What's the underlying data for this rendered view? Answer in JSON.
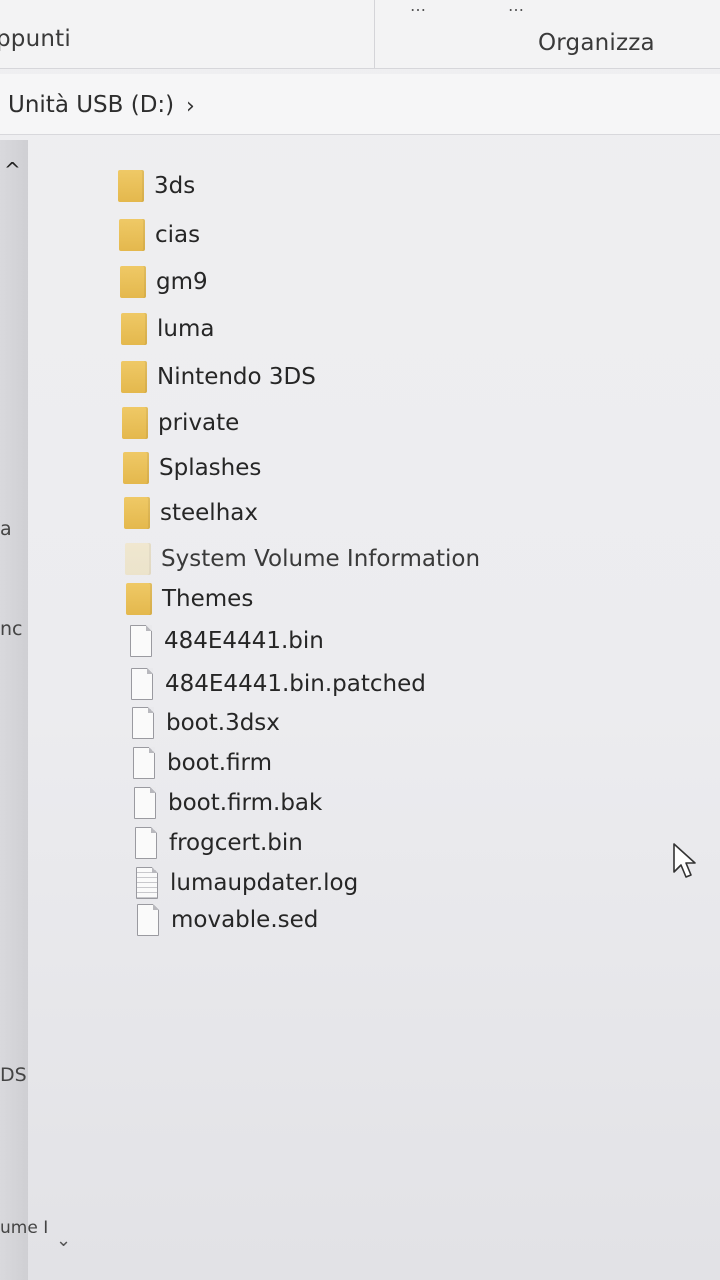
{
  "ribbon": {
    "clipboard_label": "ppunti",
    "organize_label": "Organizza",
    "dots_left": "…",
    "dots_right": "…"
  },
  "address": {
    "path": "Unità USB (D:)",
    "chevron": "›"
  },
  "nav": {
    "scroll_up": "^",
    "fragments": [
      "a",
      "nc",
      "DS",
      "ume I"
    ],
    "scroll_down": "⌄"
  },
  "files": [
    {
      "name": "3ds",
      "type": "folder"
    },
    {
      "name": "cias",
      "type": "folder"
    },
    {
      "name": "gm9",
      "type": "folder"
    },
    {
      "name": "luma",
      "type": "folder"
    },
    {
      "name": "Nintendo 3DS",
      "type": "folder"
    },
    {
      "name": "private",
      "type": "folder"
    },
    {
      "name": "Splashes",
      "type": "folder"
    },
    {
      "name": "steelhax",
      "type": "folder"
    },
    {
      "name": "System Volume Information",
      "type": "folder-hidden"
    },
    {
      "name": "Themes",
      "type": "folder"
    },
    {
      "name": "484E4441.bin",
      "type": "file"
    },
    {
      "name": "484E4441.bin.patched",
      "type": "file"
    },
    {
      "name": "boot.3dsx",
      "type": "file"
    },
    {
      "name": "boot.firm",
      "type": "file"
    },
    {
      "name": "boot.firm.bak",
      "type": "file"
    },
    {
      "name": "frogcert.bin",
      "type": "file"
    },
    {
      "name": "lumaupdater.log",
      "type": "text-file"
    },
    {
      "name": "movable.sed",
      "type": "file"
    }
  ],
  "colors": {
    "folder": "#e8bd55",
    "hidden_folder": "#eee2c2",
    "background": "#ececef"
  }
}
